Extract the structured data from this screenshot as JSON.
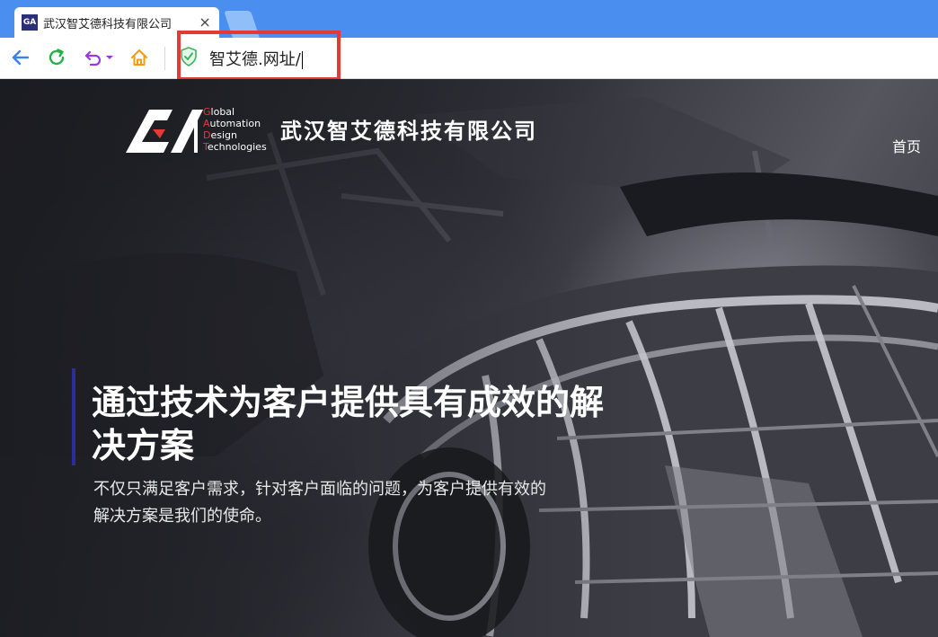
{
  "browser": {
    "tab_title": "武汉智艾德科技有限公司",
    "tab_close": "×",
    "favicon_text": "GA",
    "address": "智艾德.网址/",
    "icons": [
      "back-icon",
      "refresh-icon",
      "undo-icon",
      "chevron-down-icon",
      "home-icon",
      "shield-icon"
    ],
    "accent_color": "#4a8ff0",
    "highlight_color": "#e53935"
  },
  "site": {
    "logo_lines": [
      "lobal",
      "utomation",
      "esign",
      "echnologies"
    ],
    "logo_initials": [
      "G",
      "A",
      "D",
      "T"
    ],
    "company_name": "武汉智艾德科技有限公司",
    "nav": {
      "home": "首页"
    }
  },
  "hero": {
    "headline": "通过技术为客户提供具有成效的解决方案",
    "subtext": "不仅只满足客户需求，针对客户面临的问题，为客户提供有效的解决方案是我们的使命。"
  }
}
